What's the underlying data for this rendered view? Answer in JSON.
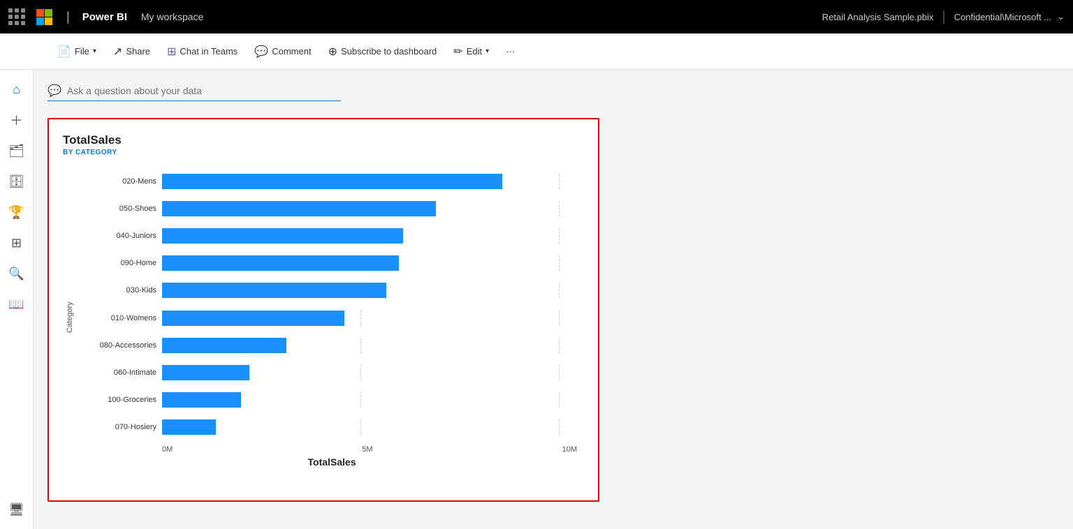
{
  "topbar": {
    "brand": "Power BI",
    "workspace": "My workspace",
    "filename": "Retail Analysis Sample.pbix",
    "separator": "|",
    "confidential": "Confidential\\Microsoft ...",
    "chevron": "⌄"
  },
  "toolbar": {
    "hamburger_label": "Menu",
    "file_label": "File",
    "share_label": "Share",
    "chat_label": "Chat in Teams",
    "comment_label": "Comment",
    "subscribe_label": "Subscribe to dashboard",
    "edit_label": "Edit",
    "more_label": "···"
  },
  "sidebar": {
    "items": [
      {
        "icon": "⌂",
        "name": "home-icon",
        "label": "Home"
      },
      {
        "icon": "+",
        "name": "create-icon",
        "label": "Create"
      },
      {
        "icon": "🗂",
        "name": "browse-icon",
        "label": "Browse"
      },
      {
        "icon": "🗄",
        "name": "data-icon",
        "label": "Data hub"
      },
      {
        "icon": "🏆",
        "name": "goals-icon",
        "label": "Goals"
      },
      {
        "icon": "⊞",
        "name": "apps-icon",
        "label": "Apps"
      },
      {
        "icon": "🔍",
        "name": "metrics-icon",
        "label": "Metrics"
      },
      {
        "icon": "📖",
        "name": "learn-icon",
        "label": "Learn"
      }
    ],
    "bottom_icon": {
      "icon": "🖥",
      "name": "workspaces-icon",
      "label": "Workspaces"
    }
  },
  "qa": {
    "placeholder": "Ask a question about your data",
    "icon": "💬"
  },
  "chart": {
    "title": "TotalSales",
    "subtitle": "BY CATEGORY",
    "y_label": "Category",
    "x_label": "TotalSales",
    "x_axis": [
      "0M",
      "5M",
      "10M"
    ],
    "bars": [
      {
        "label": "020-Mens",
        "value": 82
      },
      {
        "label": "050-Shoes",
        "value": 66
      },
      {
        "label": "040-Juniors",
        "value": 58
      },
      {
        "label": "090-Home",
        "value": 57
      },
      {
        "label": "030-Kids",
        "value": 54
      },
      {
        "label": "010-Womens",
        "value": 44
      },
      {
        "label": "080-Accessories",
        "value": 30
      },
      {
        "label": "060-Intimate",
        "value": 21
      },
      {
        "label": "100-Groceries",
        "value": 19
      },
      {
        "label": "070-Hosiery",
        "value": 13
      }
    ],
    "bar_color": "#1a8fff",
    "grid_line_1_pct": "47.8",
    "grid_line_2_pct": "95.6"
  }
}
